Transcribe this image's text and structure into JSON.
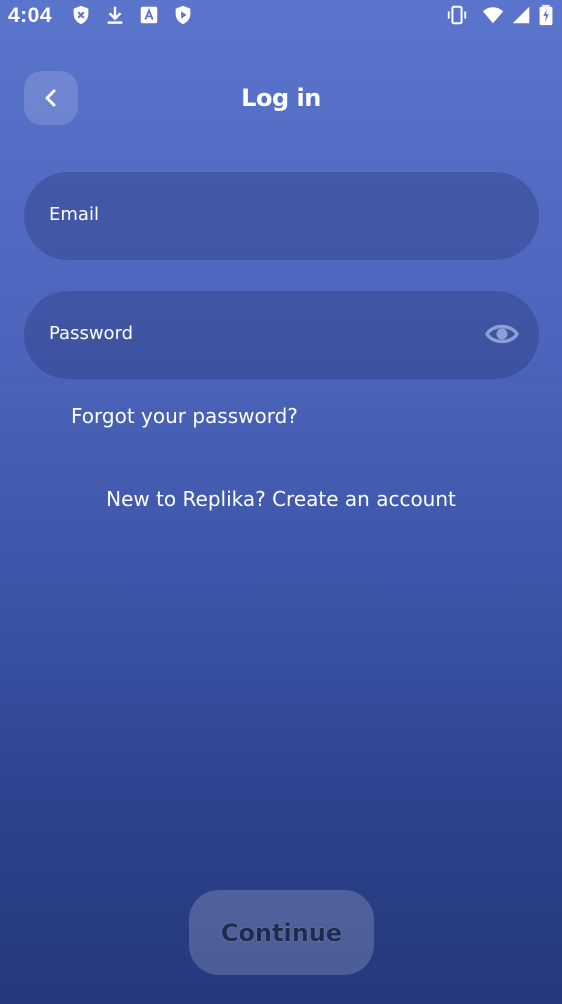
{
  "status_bar": {
    "time": "4:04",
    "left_icons": [
      "shield-x-icon",
      "download-icon",
      "translate-icon",
      "play-shield-icon"
    ],
    "right_icons": [
      "vibrate-icon",
      "wifi-icon",
      "signal-icon",
      "battery-charging-icon"
    ]
  },
  "header": {
    "back_icon": "chevron-left-icon",
    "title": "Log in"
  },
  "form": {
    "email_label": "Email",
    "email_value": "",
    "password_label": "Password",
    "password_value": "",
    "password_toggle_icon": "eye-icon"
  },
  "links": {
    "forgot": "Forgot your password?",
    "create_account": "New to Replika? Create an account"
  },
  "actions": {
    "continue": "Continue"
  },
  "colors": {
    "background_top": "#5b75cc",
    "background_bottom": "#25387c",
    "continue_text": "#1e2a4e"
  }
}
